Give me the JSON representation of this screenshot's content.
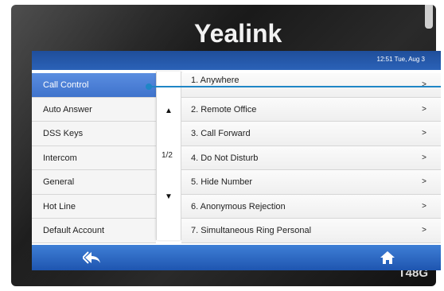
{
  "brand": "Yealink",
  "model": "T48G",
  "status": {
    "time": "12:51 Tue, Aug 3"
  },
  "left_menu": [
    {
      "label": "Call Control",
      "active": true
    },
    {
      "label": "Auto Answer"
    },
    {
      "label": "DSS Keys"
    },
    {
      "label": "Intercom"
    },
    {
      "label": "General"
    },
    {
      "label": "Hot Line"
    },
    {
      "label": "Default Account"
    }
  ],
  "pager": {
    "page": "1/2",
    "up_icon": "triangle-up",
    "down_icon": "triangle-down"
  },
  "right_list": [
    {
      "label": "1. Anywhere",
      "arrow": ">"
    },
    {
      "label": "2. Remote Office",
      "arrow": ">"
    },
    {
      "label": "3. Call Forward",
      "arrow": ">"
    },
    {
      "label": "4. Do Not Disturb",
      "arrow": ">"
    },
    {
      "label": "5. Hide Number",
      "arrow": ">"
    },
    {
      "label": "6. Anonymous Rejection",
      "arrow": ">"
    },
    {
      "label": "7. Simultaneous Ring Personal",
      "arrow": ">"
    }
  ],
  "bottom_bar": {
    "back_icon": "back-arrow",
    "home_icon": "home"
  },
  "colors": {
    "accent": "#3f73cc",
    "callout": "#1f86c6",
    "bar": "#2b62b8"
  }
}
